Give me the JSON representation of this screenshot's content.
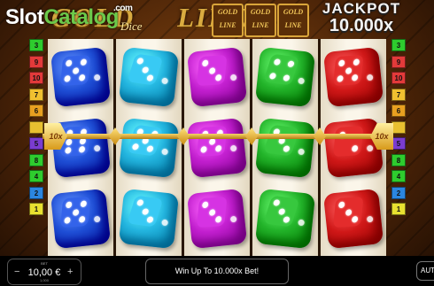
{
  "watermark": {
    "slot": "Slot",
    "catalog": "Catalog",
    "com": ".com"
  },
  "game": {
    "title_left": "GOLD",
    "title_right": "LINE",
    "title_sub": "Dice",
    "badges": [
      "GOLD LINE",
      "GOLD LINE",
      "GOLD LINE"
    ],
    "jackpot_label": "JACKPOT",
    "jackpot_value": "10.000x"
  },
  "paylines": {
    "left": [
      "3",
      "9",
      "10",
      "7",
      "6",
      "",
      "5",
      "8",
      "4",
      "2",
      "1"
    ],
    "right": [
      "3",
      "9",
      "10",
      "7",
      "6",
      "",
      "5",
      "8",
      "4",
      "2",
      "1"
    ],
    "colors": [
      "#2ecc2e",
      "#e23a3a",
      "#e23a3a",
      "#f0c030",
      "#e8a020",
      "#e8c030",
      "#7a3cd0",
      "#2ecc2e",
      "#2ecc2e",
      "#2b86e0",
      "#e8e030"
    ]
  },
  "multiplier_label": "10x",
  "reels": [
    {
      "color": "#1f4fd6",
      "rows": [
        5,
        6,
        5
      ]
    },
    {
      "color": "#24b6e0",
      "rows": [
        3,
        5,
        3
      ]
    },
    {
      "color": "#c21fcf",
      "rows": [
        3,
        5,
        3
      ]
    },
    {
      "color": "#23b42a",
      "rows": [
        4,
        3,
        3
      ]
    },
    {
      "color": "#d01818",
      "rows": [
        5,
        2,
        3
      ]
    }
  ],
  "controls": {
    "bet_label": "BET",
    "bet_value": "10,00 €",
    "bet_sub": "1,000",
    "minus": "−",
    "plus": "+",
    "message": "Win Up To 10.000x Bet!",
    "auto": "AUTO"
  },
  "colors": {
    "gold": "#e8b23a",
    "line": "#d9a53a"
  }
}
